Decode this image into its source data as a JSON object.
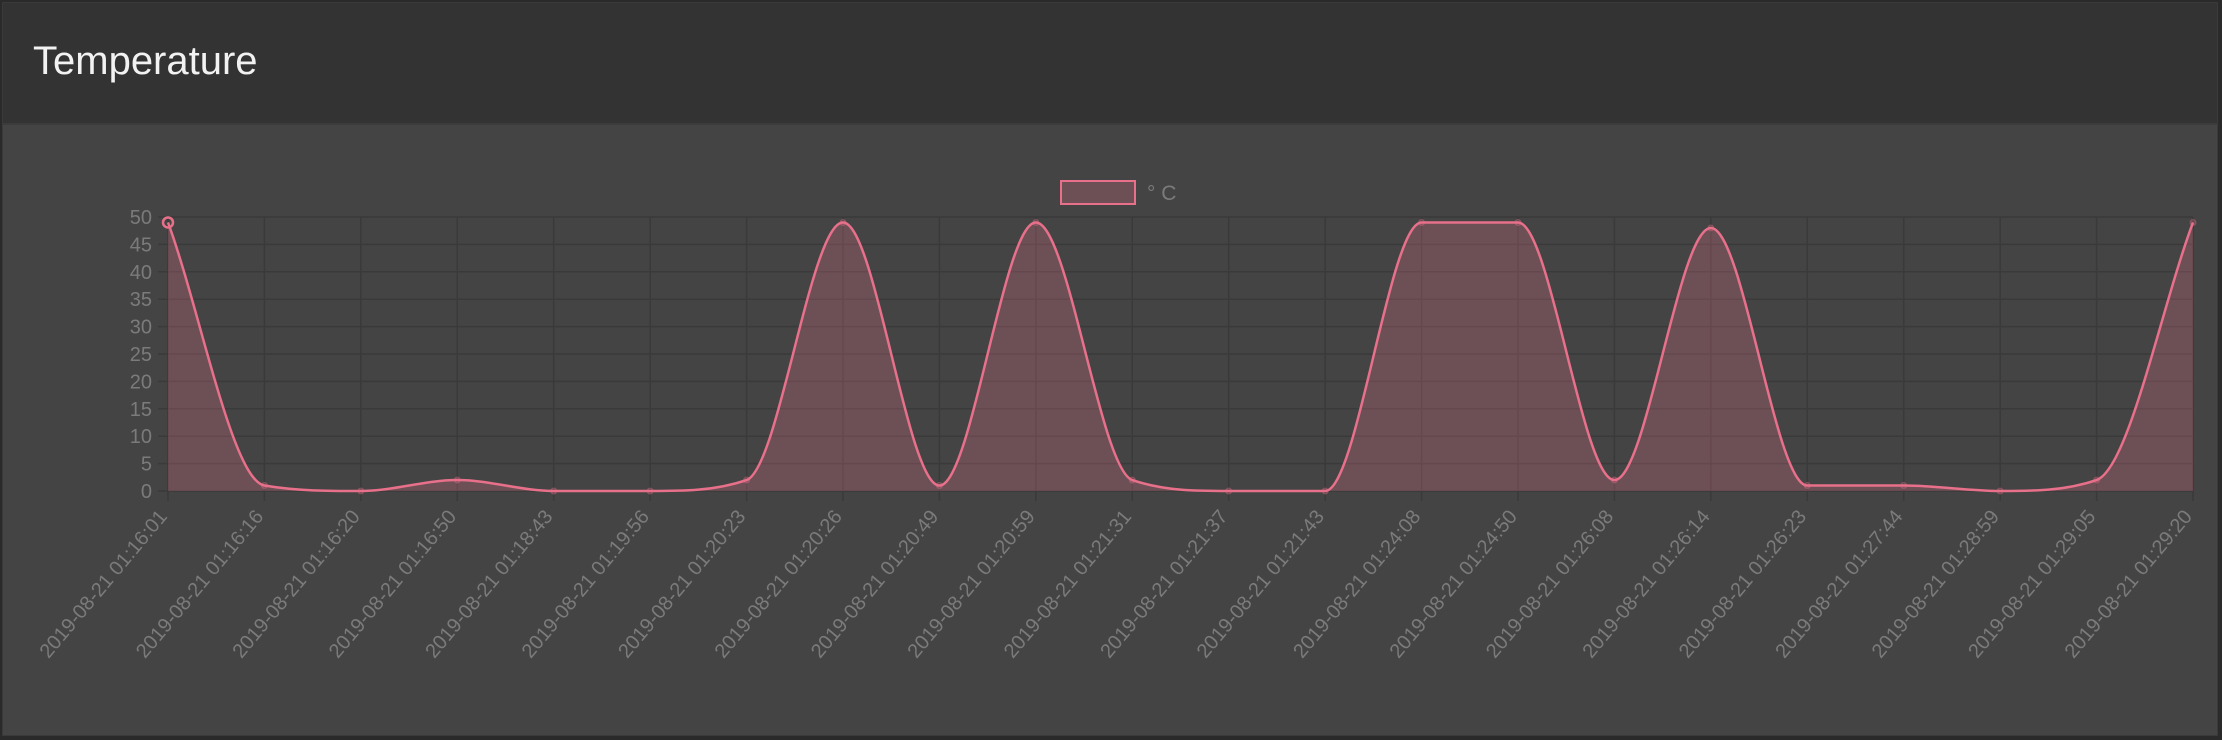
{
  "header": {
    "title": "Temperature"
  },
  "colors": {
    "line": "#e8708a",
    "fill": "rgba(232,112,138,0.25)",
    "grid": "#3a3a3a",
    "text": "#7b7b7b"
  },
  "chart_data": {
    "type": "area",
    "title": "",
    "xlabel": "",
    "ylabel": "",
    "ylim": [
      0,
      50
    ],
    "yticks": [
      0,
      5,
      10,
      15,
      20,
      25,
      30,
      35,
      40,
      45,
      50
    ],
    "grid": true,
    "legend_position": "top-center",
    "categories": [
      "2019-08-21 01:16:01",
      "2019-08-21 01:16:16",
      "2019-08-21 01:16:20",
      "2019-08-21 01:16:50",
      "2019-08-21 01:18:43",
      "2019-08-21 01:19:56",
      "2019-08-21 01:20:23",
      "2019-08-21 01:20:26",
      "2019-08-21 01:20:49",
      "2019-08-21 01:20:59",
      "2019-08-21 01:21:31",
      "2019-08-21 01:21:37",
      "2019-08-21 01:21:43",
      "2019-08-21 01:24:08",
      "2019-08-21 01:24:50",
      "2019-08-21 01:26:08",
      "2019-08-21 01:26:14",
      "2019-08-21 01:26:23",
      "2019-08-21 01:27:44",
      "2019-08-21 01:28:59",
      "2019-08-21 01:29:05",
      "2019-08-21 01:29:20"
    ],
    "series": [
      {
        "name": "° C",
        "values": [
          49,
          1,
          0,
          2,
          0,
          0,
          2,
          49,
          1,
          49,
          2,
          0,
          0,
          49,
          49,
          2,
          48,
          1,
          1,
          0,
          2,
          49
        ]
      }
    ]
  }
}
